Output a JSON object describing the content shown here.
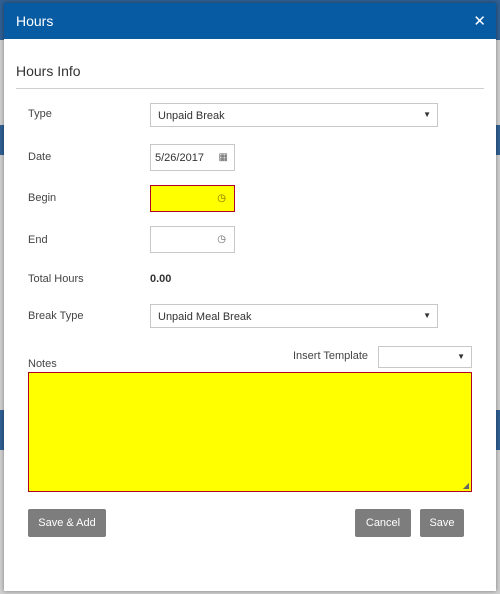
{
  "dialog": {
    "title": "Hours",
    "close_icon": "close-icon"
  },
  "section": {
    "title": "Hours Info"
  },
  "fields": {
    "type": {
      "label": "Type",
      "value": "Unpaid Break"
    },
    "date": {
      "label": "Date",
      "value": "5/26/2017"
    },
    "begin": {
      "label": "Begin",
      "value": ""
    },
    "end": {
      "label": "End",
      "value": ""
    },
    "total_hours": {
      "label": "Total Hours",
      "value": "0.00"
    },
    "break_type": {
      "label": "Break Type",
      "value": "Unpaid Meal Break"
    },
    "notes": {
      "label": "Notes",
      "value": ""
    },
    "insert_template": {
      "label": "Insert Template",
      "value": ""
    }
  },
  "buttons": {
    "save_add": "Save & Add",
    "cancel": "Cancel",
    "save": "Save"
  },
  "colors": {
    "header": "#075ba3",
    "highlight": "#ffff00",
    "button": "#7d7d7d"
  }
}
